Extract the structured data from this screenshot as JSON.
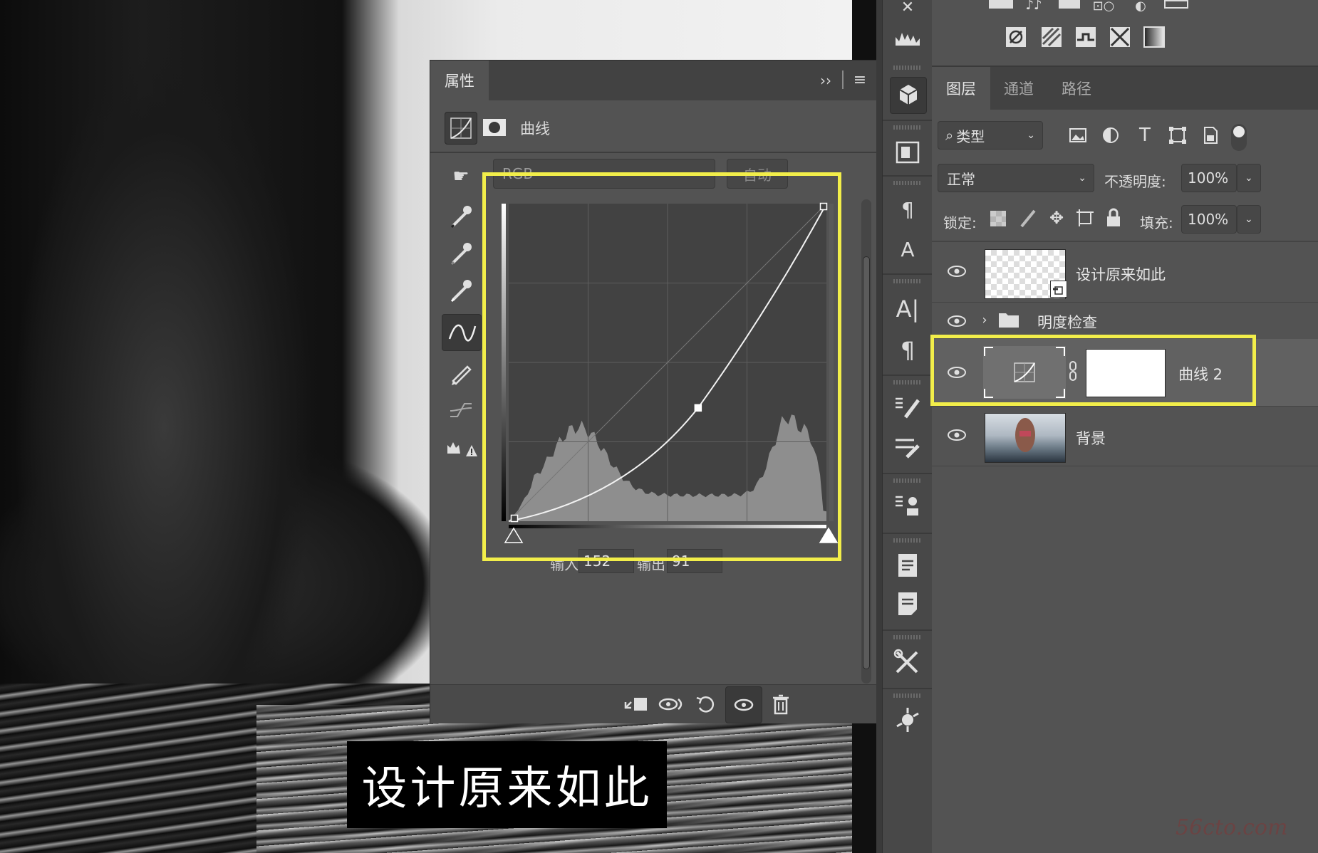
{
  "caption": "设计原来如此",
  "properties_panel": {
    "tab_label": "属性",
    "header_title": "曲线",
    "channel_value": "RGB",
    "auto_button": "自动",
    "input_label": "输入:",
    "input_value": "152",
    "output_label": "输出:",
    "output_value": "91",
    "curve_point": {
      "input": 152,
      "output": 91
    },
    "histogram_color": "#8e8e8e"
  },
  "layers_panel": {
    "tabs": [
      "图层",
      "通道",
      "路径"
    ],
    "filter_label": "类型",
    "blend_mode": "正常",
    "opacity_label": "不透明度:",
    "opacity_value": "100%",
    "lock_label": "锁定:",
    "fill_label": "填充:",
    "fill_value": "100%",
    "layers": [
      {
        "name": "设计原来如此",
        "type": "smart-object"
      },
      {
        "name": "明度检查",
        "type": "group"
      },
      {
        "name": "曲线 2",
        "type": "curves-adjustment",
        "selected": true
      },
      {
        "name": "背景",
        "type": "image"
      }
    ]
  },
  "watermark": "56cto.com",
  "highlight_color": "#f2ee4a"
}
